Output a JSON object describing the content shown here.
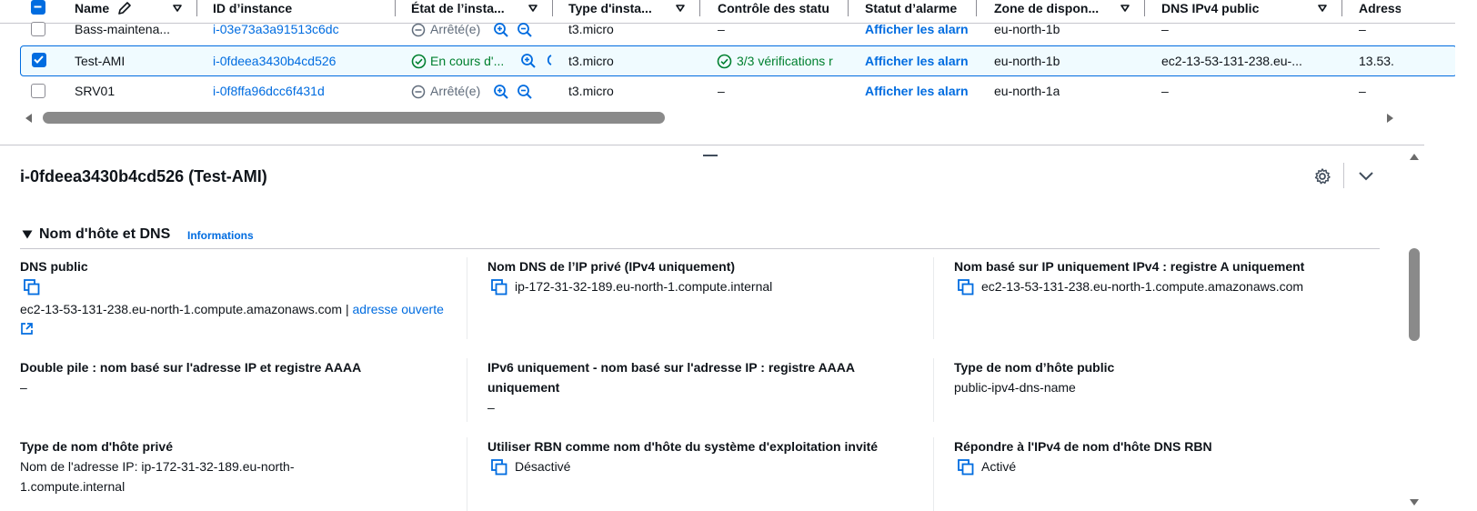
{
  "table": {
    "columns": [
      "Name",
      "ID d’instance",
      "État de l’insta...",
      "Type d'insta...",
      "Contrôle des statu",
      "Statut d’alarme",
      "Zone de dispon...",
      "DNS IPv4 public",
      "Adress"
    ],
    "rows": [
      {
        "name": "Bass-maintena...",
        "id": "i-03e73a3a91513c6dc",
        "state": "Arrêté(e)",
        "type": "t3.micro",
        "status": "–",
        "alarm": "Afficher les alarn",
        "zone": "eu-north-1b",
        "dns": "–",
        "addr": "–",
        "selected": false
      },
      {
        "name": "Test-AMI",
        "id": "i-0fdeea3430b4cd526",
        "state": "En cours d'...",
        "type": "t3.micro",
        "status": "3/3 vérifications r",
        "alarm": "Afficher les alarn",
        "zone": "eu-north-1b",
        "dns": "ec2-13-53-131-238.eu-...",
        "addr": "13.53.",
        "selected": true
      },
      {
        "name": "SRV01",
        "id": "i-0f8ffa96dcc6f431d",
        "state": "Arrêté(e)",
        "type": "t3.micro",
        "status": "–",
        "alarm": "Afficher les alarn",
        "zone": "eu-north-1a",
        "dns": "–",
        "addr": "–",
        "selected": false
      }
    ]
  },
  "details": {
    "title": "i-0fdeea3430b4cd526 (Test-AMI)",
    "section_title": "Nom d'hôte et DNS",
    "section_info": "Informations",
    "fields": {
      "public_dns_label": "DNS public",
      "public_dns_value": "ec2-13-53-131-238.eu-north-1.compute.amazonaws.com |",
      "public_dns_link": "adresse ouverte",
      "private_dns_label": "Nom DNS de l’IP privé (IPv4 uniquement)",
      "private_dns_value": "ip-172-31-32-189.eu-north-1.compute.internal",
      "ipv4_a_label": "Nom basé sur IP uniquement IPv4 : registre A uniquement",
      "ipv4_a_value": "ec2-13-53-131-238.eu-north-1.compute.amazonaws.com",
      "dual_stack_label": "Double pile : nom basé sur l'adresse IP et registre AAAA",
      "dual_stack_value": "–",
      "ipv6_label": "IPv6 uniquement - nom basé sur l'adresse IP : registre AAAA uniquement",
      "ipv6_value": "–",
      "public_hostname_type_label": "Type de nom d’hôte public",
      "public_hostname_type_value": "public-ipv4-dns-name",
      "private_hostname_type_label": "Type de nom d'hôte privé",
      "private_hostname_type_value": "Nom de l'adresse IP: ip-172-31-32-189.eu-north-1.compute.internal",
      "rbn_os_label": "Utiliser RBN comme nom d'hôte du système d'exploitation invité",
      "rbn_os_value": "Désactivé",
      "rbn_ipv4_label": "Répondre à l'IPv4 de nom d'hôte DNS RBN",
      "rbn_ipv4_value": "Activé"
    }
  },
  "colors": {
    "link": "#006ce0",
    "success": "#00802f",
    "muted": "#5f6b7a",
    "selected_row_bg": "#f0fbff"
  }
}
